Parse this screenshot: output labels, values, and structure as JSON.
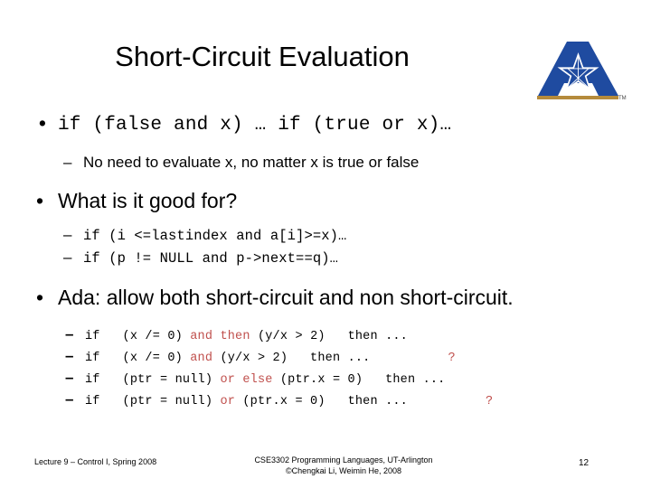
{
  "slide": {
    "title": "Short-Circuit Evaluation",
    "page_number": "12"
  },
  "logo": {
    "name": "ut-arlington-a-logo",
    "letter": "A",
    "trademark": "TM",
    "blue": "#1f4ba0",
    "gold": "#b58b3c"
  },
  "content": {
    "b1": {
      "bullet": "•",
      "text": "if (false and x) … if (true or x)…"
    },
    "b1_sub": {
      "dash": "–",
      "text": "No need to evaluate x, no matter x is true or false"
    },
    "b2": {
      "bullet": "•",
      "text": "What is it good for?"
    },
    "b2_subs": [
      {
        "dash": "–",
        "text": "if (i <=lastindex and a[i]>=x)…"
      },
      {
        "dash": "–",
        "text": "if (p != NULL and p->next==q)…"
      }
    ],
    "b3": {
      "bullet": "•",
      "text": "Ada: allow both short-circuit and non short-circuit."
    },
    "b3_subs": [
      {
        "dash": "–",
        "pre": "if   ",
        "expr1": "(x /= 0) ",
        "keyword": "and then",
        "expr2": " (y/x > 2)   then ...",
        "mark": ""
      },
      {
        "dash": "–",
        "pre": "if   ",
        "expr1": "(x /= 0) ",
        "keyword": "and",
        "expr2": " (y/x > 2)   then ...",
        "mark": "?"
      },
      {
        "dash": "–",
        "pre": "if   ",
        "expr1": "(ptr = null) ",
        "keyword": "or else",
        "expr2": " (ptr.x = 0)   then ...",
        "mark": ""
      },
      {
        "dash": "–",
        "pre": "if   ",
        "expr1": "(ptr = null) ",
        "keyword": "or",
        "expr2": " (ptr.x = 0)   then ...",
        "mark": "?"
      }
    ]
  },
  "footer": {
    "left": "Lecture 9 – Control I, Spring 2008",
    "center_line1": "CSE3302 Programming Languages, UT-Arlington",
    "center_line2": "©Chengkai Li, Weimin He, 2008"
  },
  "colors": {
    "keyword_red": "#c0504d",
    "text_black": "#000000",
    "background": "#ffffff"
  }
}
